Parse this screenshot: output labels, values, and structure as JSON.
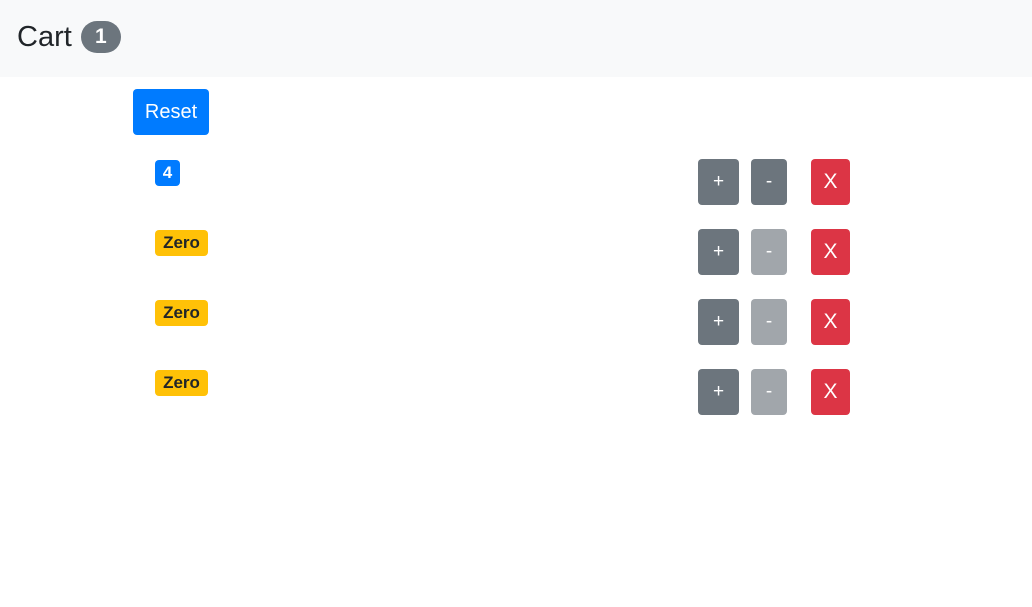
{
  "navbar": {
    "brand": "Cart",
    "count": "1"
  },
  "reset_label": "Reset",
  "counters": [
    {
      "value_label": "4",
      "increment_label": "+",
      "decrement_label": "-",
      "delete_label": "X",
      "decrement_disabled": false,
      "badge_style": "primary"
    },
    {
      "value_label": "Zero",
      "increment_label": "+",
      "decrement_label": "-",
      "delete_label": "X",
      "decrement_disabled": true,
      "badge_style": "warning"
    },
    {
      "value_label": "Zero",
      "increment_label": "+",
      "decrement_label": "-",
      "delete_label": "X",
      "decrement_disabled": true,
      "badge_style": "warning"
    },
    {
      "value_label": "Zero",
      "increment_label": "+",
      "decrement_label": "-",
      "delete_label": "X",
      "decrement_disabled": true,
      "badge_style": "warning"
    }
  ],
  "colors": {
    "primary": "#007bff",
    "secondary": "#6c757d",
    "warning": "#ffc107",
    "danger": "#dc3545",
    "navbar_bg": "#f8f9fa"
  }
}
